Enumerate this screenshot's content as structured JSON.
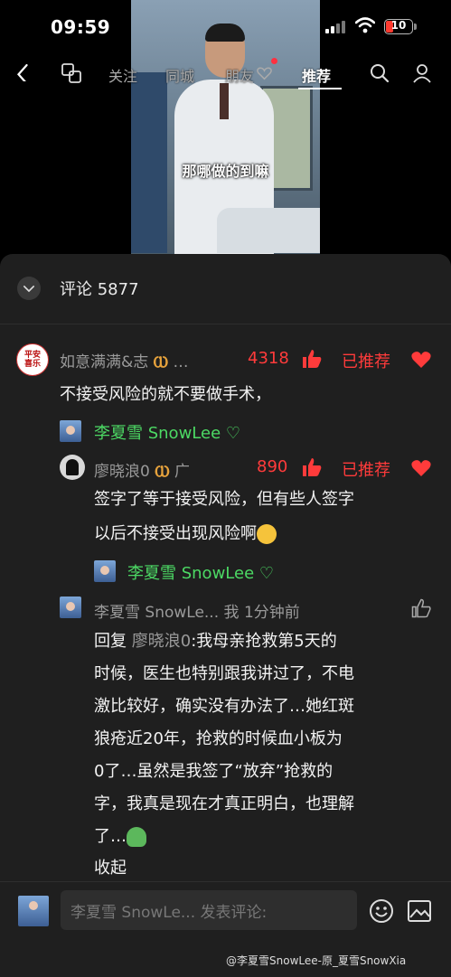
{
  "status_bar": {
    "time": "09:59",
    "battery": "10"
  },
  "video": {
    "subtitle": "那哪做的到嘛"
  },
  "nav": {
    "tabs": [
      {
        "label": "关注"
      },
      {
        "label": "同城"
      },
      {
        "label": "朋友"
      },
      {
        "label": "推荐"
      }
    ]
  },
  "comments_panel": {
    "title": "评论 5877"
  },
  "comment_main": {
    "user": "如意满满&志",
    "avatar_text": "平安喜乐",
    "likes": "4318",
    "recommended": "已推荐",
    "text": "不接受风险的就不要做手术，",
    "liked_by": "李夏雪 SnowLee"
  },
  "reply_1": {
    "user": "廖晓浪0",
    "suffix": "广",
    "likes": "890",
    "recommended": "已推荐",
    "text_line1": "签字了等于接受风险，但有些人签字",
    "text_line2": "以后不接受出现风险啊",
    "liked_by": "李夏雪 SnowLee"
  },
  "reply_2": {
    "user": "李夏雪 SnowLe...",
    "tag": "我",
    "time": "1分钟前",
    "reply_prefix": "回复",
    "reply_to": "廖晓浪0",
    "lines": [
      ":我母亲抢救第5天的",
      "时候，医生也特别跟我讲过了，不电",
      "激比较好，确实没有办法了…她红斑",
      "狼疮近20年，抢救的时候血小板为",
      "0了…虽然是我签了“放弃”抢救的",
      "字，我真是现在才真正明白，也理解",
      "了…"
    ],
    "collapse": "收起"
  },
  "bottom_bar": {
    "placeholder": "李夏雪 SnowLe... 发表评论:"
  },
  "watermark": "@李夏雪SnowLee-原_夏雪SnowXia",
  "colors": {
    "accent_red": "#ff3b3b",
    "liked_green": "#4cd964",
    "panel_bg": "#1f1f1f"
  }
}
